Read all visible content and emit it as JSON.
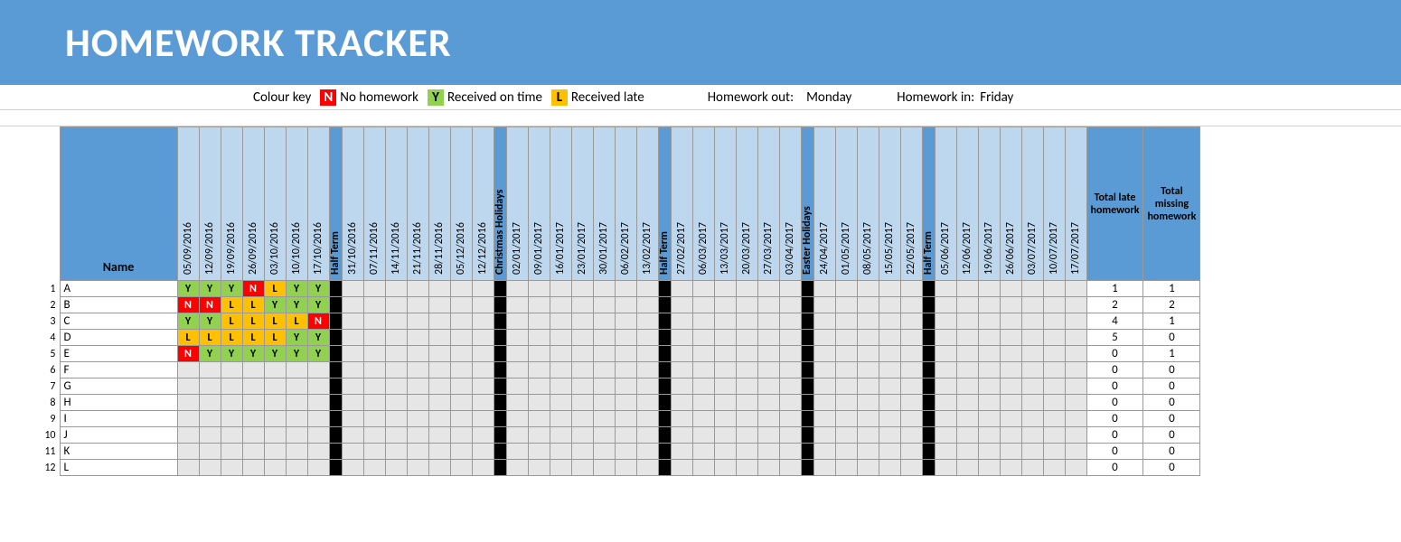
{
  "title": "HOMEWORK TRACKER",
  "legend": {
    "label": "Colour key",
    "n_key": "N",
    "n_text": "No homework",
    "y_key": "Y",
    "y_text": "Received on time",
    "l_key": "L",
    "l_text": "Received late"
  },
  "meta": {
    "out_label": "Homework out:",
    "out_day": "Monday",
    "in_label": "Homework in:",
    "in_day": "Friday"
  },
  "headers": {
    "name": "Name",
    "total_late": "Total late homework",
    "total_missing": "Total missing homework"
  },
  "columns": [
    {
      "t": "date",
      "label": "05/09/2016"
    },
    {
      "t": "date",
      "label": "12/09/2016"
    },
    {
      "t": "date",
      "label": "19/09/2016"
    },
    {
      "t": "date",
      "label": "26/09/2016"
    },
    {
      "t": "date",
      "label": "03/10/2016"
    },
    {
      "t": "date",
      "label": "10/10/2016"
    },
    {
      "t": "date",
      "label": "17/10/2016"
    },
    {
      "t": "break",
      "label": "Half Term"
    },
    {
      "t": "date",
      "label": "31/10/2016"
    },
    {
      "t": "date",
      "label": "07/11/2016"
    },
    {
      "t": "date",
      "label": "14/11/2016"
    },
    {
      "t": "date",
      "label": "21/11/2016"
    },
    {
      "t": "date",
      "label": "28/11/2016"
    },
    {
      "t": "date",
      "label": "05/12/2016"
    },
    {
      "t": "date",
      "label": "12/12/2016"
    },
    {
      "t": "break",
      "label": "Christmas Holidays"
    },
    {
      "t": "date",
      "label": "02/01/2017"
    },
    {
      "t": "date",
      "label": "09/01/2017"
    },
    {
      "t": "date",
      "label": "16/01/2017"
    },
    {
      "t": "date",
      "label": "23/01/2017"
    },
    {
      "t": "date",
      "label": "30/01/2017"
    },
    {
      "t": "date",
      "label": "06/02/2017"
    },
    {
      "t": "date",
      "label": "13/02/2017"
    },
    {
      "t": "break",
      "label": "Half Term"
    },
    {
      "t": "date",
      "label": "27/02/2017"
    },
    {
      "t": "date",
      "label": "06/03/2017"
    },
    {
      "t": "date",
      "label": "13/03/2017"
    },
    {
      "t": "date",
      "label": "20/03/2017"
    },
    {
      "t": "date",
      "label": "27/03/2017"
    },
    {
      "t": "date",
      "label": "03/04/2017"
    },
    {
      "t": "break",
      "label": "Easter Holidays"
    },
    {
      "t": "date",
      "label": "24/04/2017"
    },
    {
      "t": "date",
      "label": "01/05/2017"
    },
    {
      "t": "date",
      "label": "08/05/2017"
    },
    {
      "t": "date",
      "label": "15/05/2017"
    },
    {
      "t": "date",
      "label": "22/05/2017"
    },
    {
      "t": "break",
      "label": "Half Term"
    },
    {
      "t": "date",
      "label": "05/06/2017"
    },
    {
      "t": "date",
      "label": "12/06/2017"
    },
    {
      "t": "date",
      "label": "19/06/2017"
    },
    {
      "t": "date",
      "label": "26/06/2017"
    },
    {
      "t": "date",
      "label": "03/07/2017"
    },
    {
      "t": "date",
      "label": "10/07/2017"
    },
    {
      "t": "date",
      "label": "17/07/2017"
    }
  ],
  "rows": [
    {
      "num": 1,
      "name": "A",
      "marks": [
        "Y",
        "Y",
        "Y",
        "N",
        "L",
        "Y",
        "Y"
      ],
      "late": 1,
      "missing": 1
    },
    {
      "num": 2,
      "name": "B",
      "marks": [
        "N",
        "N",
        "L",
        "L",
        "Y",
        "Y",
        "Y"
      ],
      "late": 2,
      "missing": 2
    },
    {
      "num": 3,
      "name": "C",
      "marks": [
        "Y",
        "Y",
        "L",
        "L",
        "L",
        "L",
        "N"
      ],
      "late": 4,
      "missing": 1
    },
    {
      "num": 4,
      "name": "D",
      "marks": [
        "L",
        "L",
        "L",
        "L",
        "L",
        "Y",
        "Y"
      ],
      "late": 5,
      "missing": 0
    },
    {
      "num": 5,
      "name": "E",
      "marks": [
        "N",
        "Y",
        "Y",
        "Y",
        "Y",
        "Y",
        "Y"
      ],
      "late": 0,
      "missing": 1
    },
    {
      "num": 6,
      "name": "F",
      "marks": [],
      "late": 0,
      "missing": 0
    },
    {
      "num": 7,
      "name": "G",
      "marks": [],
      "late": 0,
      "missing": 0
    },
    {
      "num": 8,
      "name": "H",
      "marks": [],
      "late": 0,
      "missing": 0
    },
    {
      "num": 9,
      "name": "I",
      "marks": [],
      "late": 0,
      "missing": 0
    },
    {
      "num": 10,
      "name": "J",
      "marks": [],
      "late": 0,
      "missing": 0
    },
    {
      "num": 11,
      "name": "K",
      "marks": [],
      "late": 0,
      "missing": 0
    },
    {
      "num": 12,
      "name": "L",
      "marks": [],
      "late": 0,
      "missing": 0
    }
  ]
}
